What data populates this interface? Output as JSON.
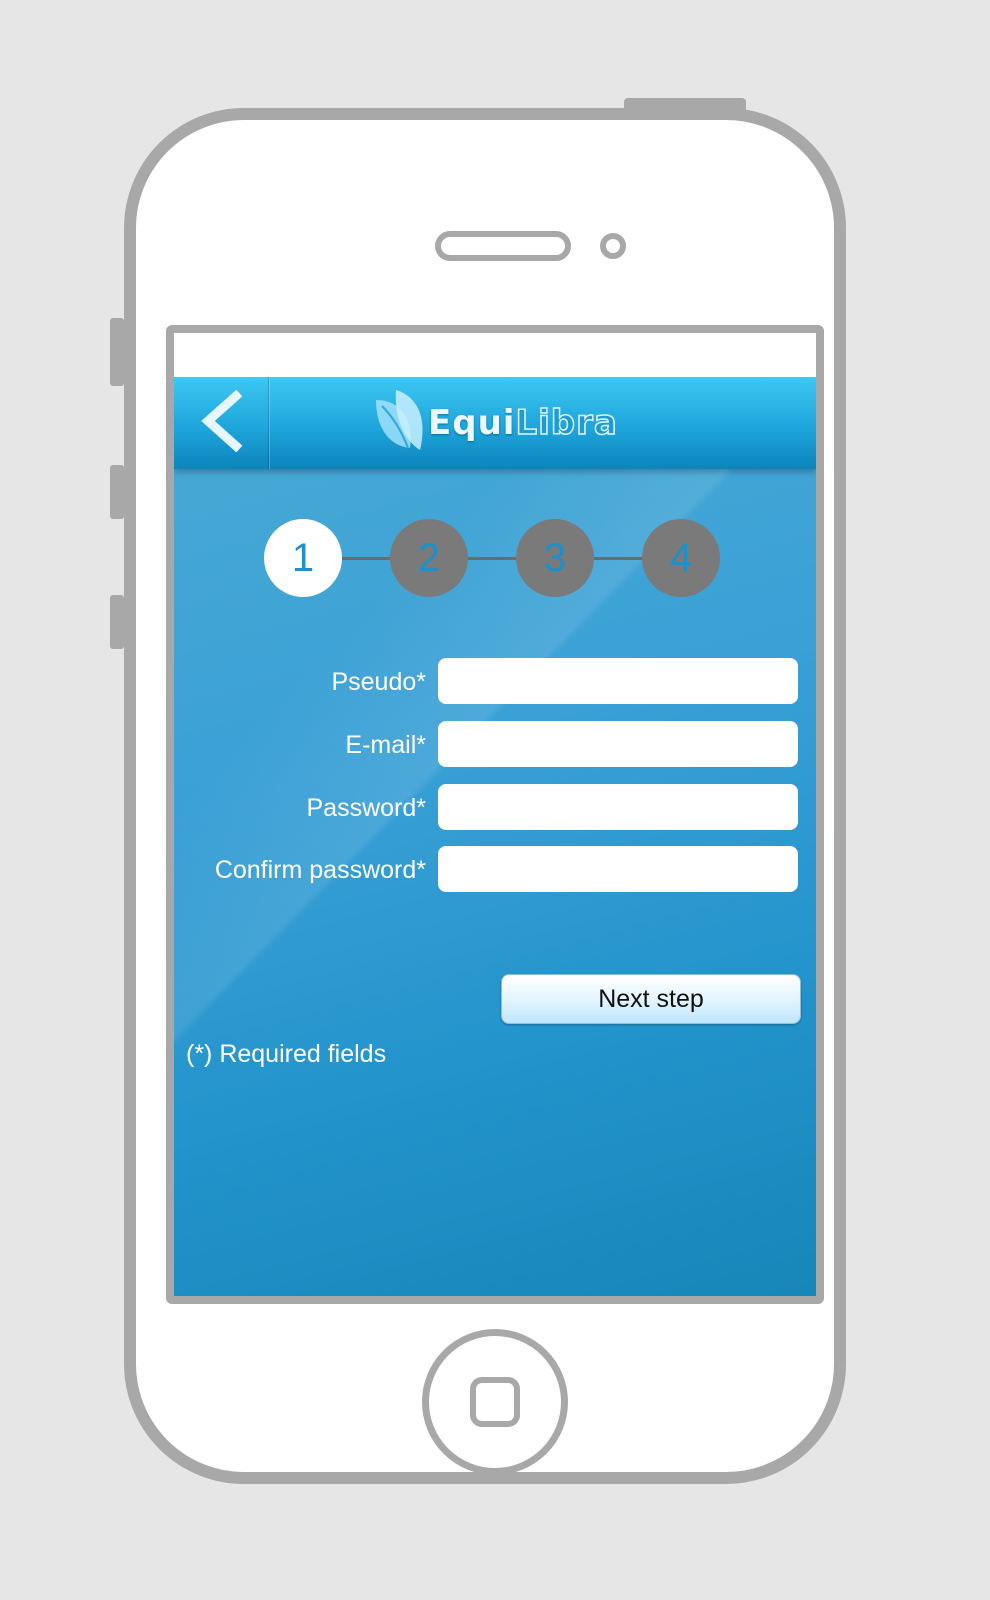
{
  "header": {
    "logo_part1": "Equi",
    "logo_part2": "Libra"
  },
  "steps": [
    {
      "label": "1",
      "active": true
    },
    {
      "label": "2",
      "active": false
    },
    {
      "label": "3",
      "active": false
    },
    {
      "label": "4",
      "active": false
    }
  ],
  "form": {
    "fields": [
      {
        "label": "Pseudo*",
        "value": ""
      },
      {
        "label": "E-mail*",
        "value": ""
      },
      {
        "label": "Password*",
        "value": ""
      },
      {
        "label": "Confirm password*",
        "value": ""
      }
    ],
    "next_button": "Next step",
    "required_note": "(*) Required fields"
  },
  "colors": {
    "header_top": "#3ec7f2",
    "header_bottom": "#0d84bb",
    "background": "#2394cc",
    "step_active": "#ffffff",
    "step_inactive": "#7a7a7a",
    "device_frame": "#a8a8a8"
  },
  "icons": {
    "back": "chevron-left-icon",
    "logo": "leaf-icon"
  }
}
